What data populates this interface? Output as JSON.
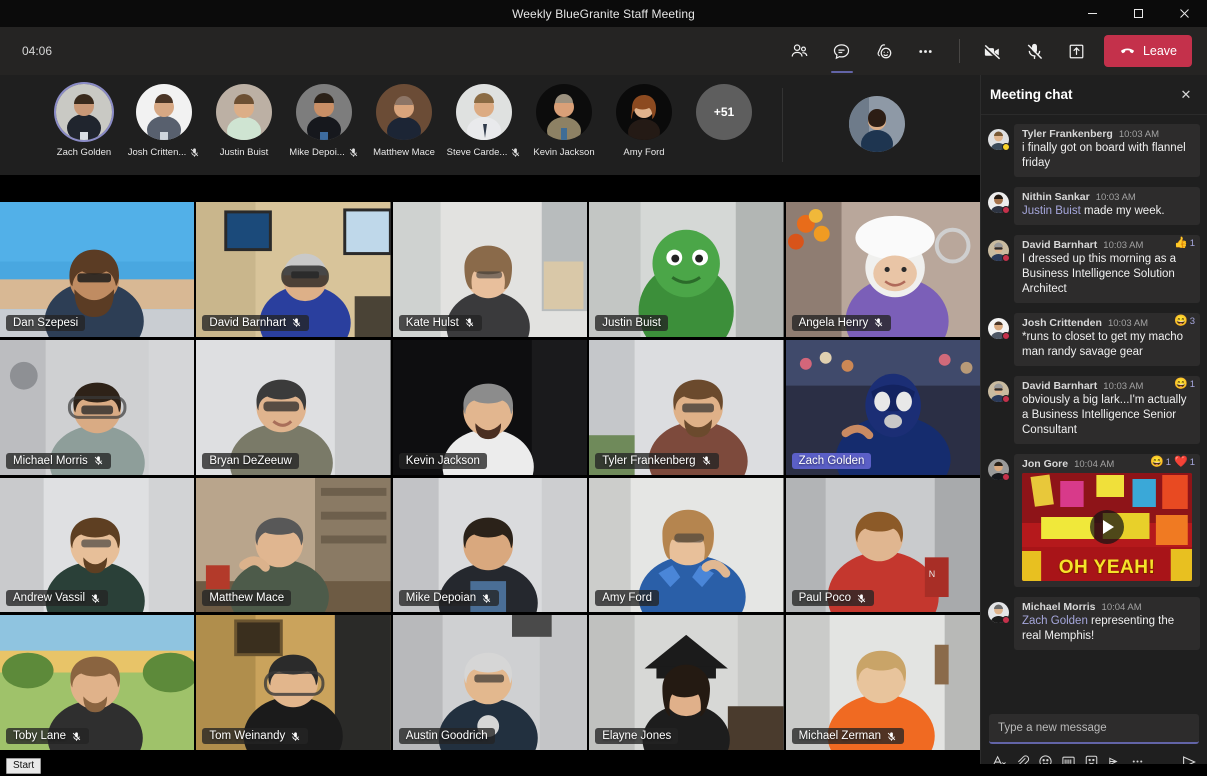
{
  "window": {
    "title": "Weekly BlueGranite Staff Meeting",
    "minimize_label": "—",
    "maximize_label": "❐",
    "close_label": "✕"
  },
  "toolbar": {
    "timer": "04:06",
    "people_label": "Show participants",
    "chat_label": "Show conversation",
    "reactions_label": "Reactions",
    "more_label": "More actions",
    "camera_label": "Turn camera on",
    "mic_label": "Unmute",
    "share_label": "Share content",
    "leave_label": "Leave",
    "accent_color": "#6264a7",
    "leave_color": "#c4314b"
  },
  "filmstrip": {
    "participants": [
      {
        "name": "Zach Golden",
        "muted": false,
        "speaking": true
      },
      {
        "name": "Josh Critten...",
        "muted": true,
        "speaking": false
      },
      {
        "name": "Justin Buist",
        "muted": false,
        "speaking": false
      },
      {
        "name": "Mike Depoi...",
        "muted": true,
        "speaking": false
      },
      {
        "name": "Matthew Mace",
        "muted": false,
        "speaking": false
      },
      {
        "name": "Steve Carde...",
        "muted": true,
        "speaking": false
      },
      {
        "name": "Kevin Jackson",
        "muted": false,
        "speaking": false
      },
      {
        "name": "Amy Ford",
        "muted": false,
        "speaking": false
      }
    ],
    "overflow_label": "+51"
  },
  "grid": {
    "tiles": [
      {
        "name": "Dan Szepesi",
        "muted": false,
        "speaking": false
      },
      {
        "name": "David Barnhart",
        "muted": true,
        "speaking": false
      },
      {
        "name": "Kate Hulst",
        "muted": true,
        "speaking": false
      },
      {
        "name": "Justin Buist",
        "muted": false,
        "speaking": false
      },
      {
        "name": "Angela Henry",
        "muted": true,
        "speaking": false
      },
      {
        "name": "Michael Morris",
        "muted": true,
        "speaking": false
      },
      {
        "name": "Bryan DeZeeuw",
        "muted": false,
        "speaking": false
      },
      {
        "name": "Kevin Jackson",
        "muted": false,
        "speaking": false
      },
      {
        "name": "Tyler Frankenberg",
        "muted": true,
        "speaking": false
      },
      {
        "name": "Zach Golden",
        "muted": false,
        "speaking": true
      },
      {
        "name": "Andrew Vassil",
        "muted": true,
        "speaking": false
      },
      {
        "name": "Matthew Mace",
        "muted": false,
        "speaking": false
      },
      {
        "name": "Mike Depoian",
        "muted": true,
        "speaking": false
      },
      {
        "name": "Amy Ford",
        "muted": false,
        "speaking": false
      },
      {
        "name": "Paul Poco",
        "muted": true,
        "speaking": false
      },
      {
        "name": "Toby Lane",
        "muted": true,
        "speaking": false
      },
      {
        "name": "Tom Weinandy",
        "muted": true,
        "speaking": false
      },
      {
        "name": "Austin Goodrich",
        "muted": false,
        "speaking": false
      },
      {
        "name": "Elayne Jones",
        "muted": false,
        "speaking": false
      },
      {
        "name": "Michael Zerman",
        "muted": true,
        "speaking": false
      }
    ]
  },
  "chat": {
    "title": "Meeting chat",
    "close_label": "✕",
    "messages": [
      {
        "author": "Tyler Frankenberg",
        "time": "10:03 AM",
        "text": "i finally got on board with flannel friday",
        "presence": "away",
        "mention": "",
        "reactions": []
      },
      {
        "author": "Nithin Sankar",
        "time": "10:03 AM",
        "mention": "Justin Buist",
        "text": " made my week.",
        "presence": "busy",
        "reactions": []
      },
      {
        "author": "David Barnhart",
        "time": "10:03 AM",
        "text": "I dressed up this morning as a Business Intelligence Solution Architect",
        "presence": "busy",
        "mention": "",
        "reactions": [
          {
            "emoji": "👍",
            "count": "1"
          }
        ]
      },
      {
        "author": "Josh Crittenden",
        "time": "10:03 AM",
        "text": "*runs to closet to get my macho man randy savage gear",
        "presence": "busy",
        "mention": "",
        "reactions": [
          {
            "emoji": "😄",
            "count": "3"
          }
        ]
      },
      {
        "author": "David Barnhart",
        "time": "10:03 AM",
        "text": "obviously a big lark...I'm actually a Business Intelligence Senior Consultant",
        "presence": "busy",
        "mention": "",
        "reactions": [
          {
            "emoji": "😄",
            "count": "1"
          }
        ]
      },
      {
        "author": "Jon Gore",
        "time": "10:04 AM",
        "text": "",
        "presence": "busy",
        "mention": "",
        "attachment": {
          "type": "video",
          "caption": "OH YEAH!"
        },
        "reactions": [
          {
            "emoji": "😄",
            "count": "1"
          },
          {
            "emoji": "❤️",
            "count": "1"
          }
        ]
      },
      {
        "author": "Michael Morris",
        "time": "10:04 AM",
        "mention": "Zach Golden",
        "text": " representing the real Memphis!",
        "presence": "busy",
        "reactions": []
      }
    ],
    "compose_placeholder": "Type a new message",
    "compose_icons": [
      "format-icon",
      "attach-icon",
      "emoji-icon",
      "giphy-icon",
      "sticker-icon",
      "priority-icon",
      "more-options-icon"
    ],
    "send_label": "Send"
  },
  "taskbar": {
    "start_tooltip": "Start"
  }
}
